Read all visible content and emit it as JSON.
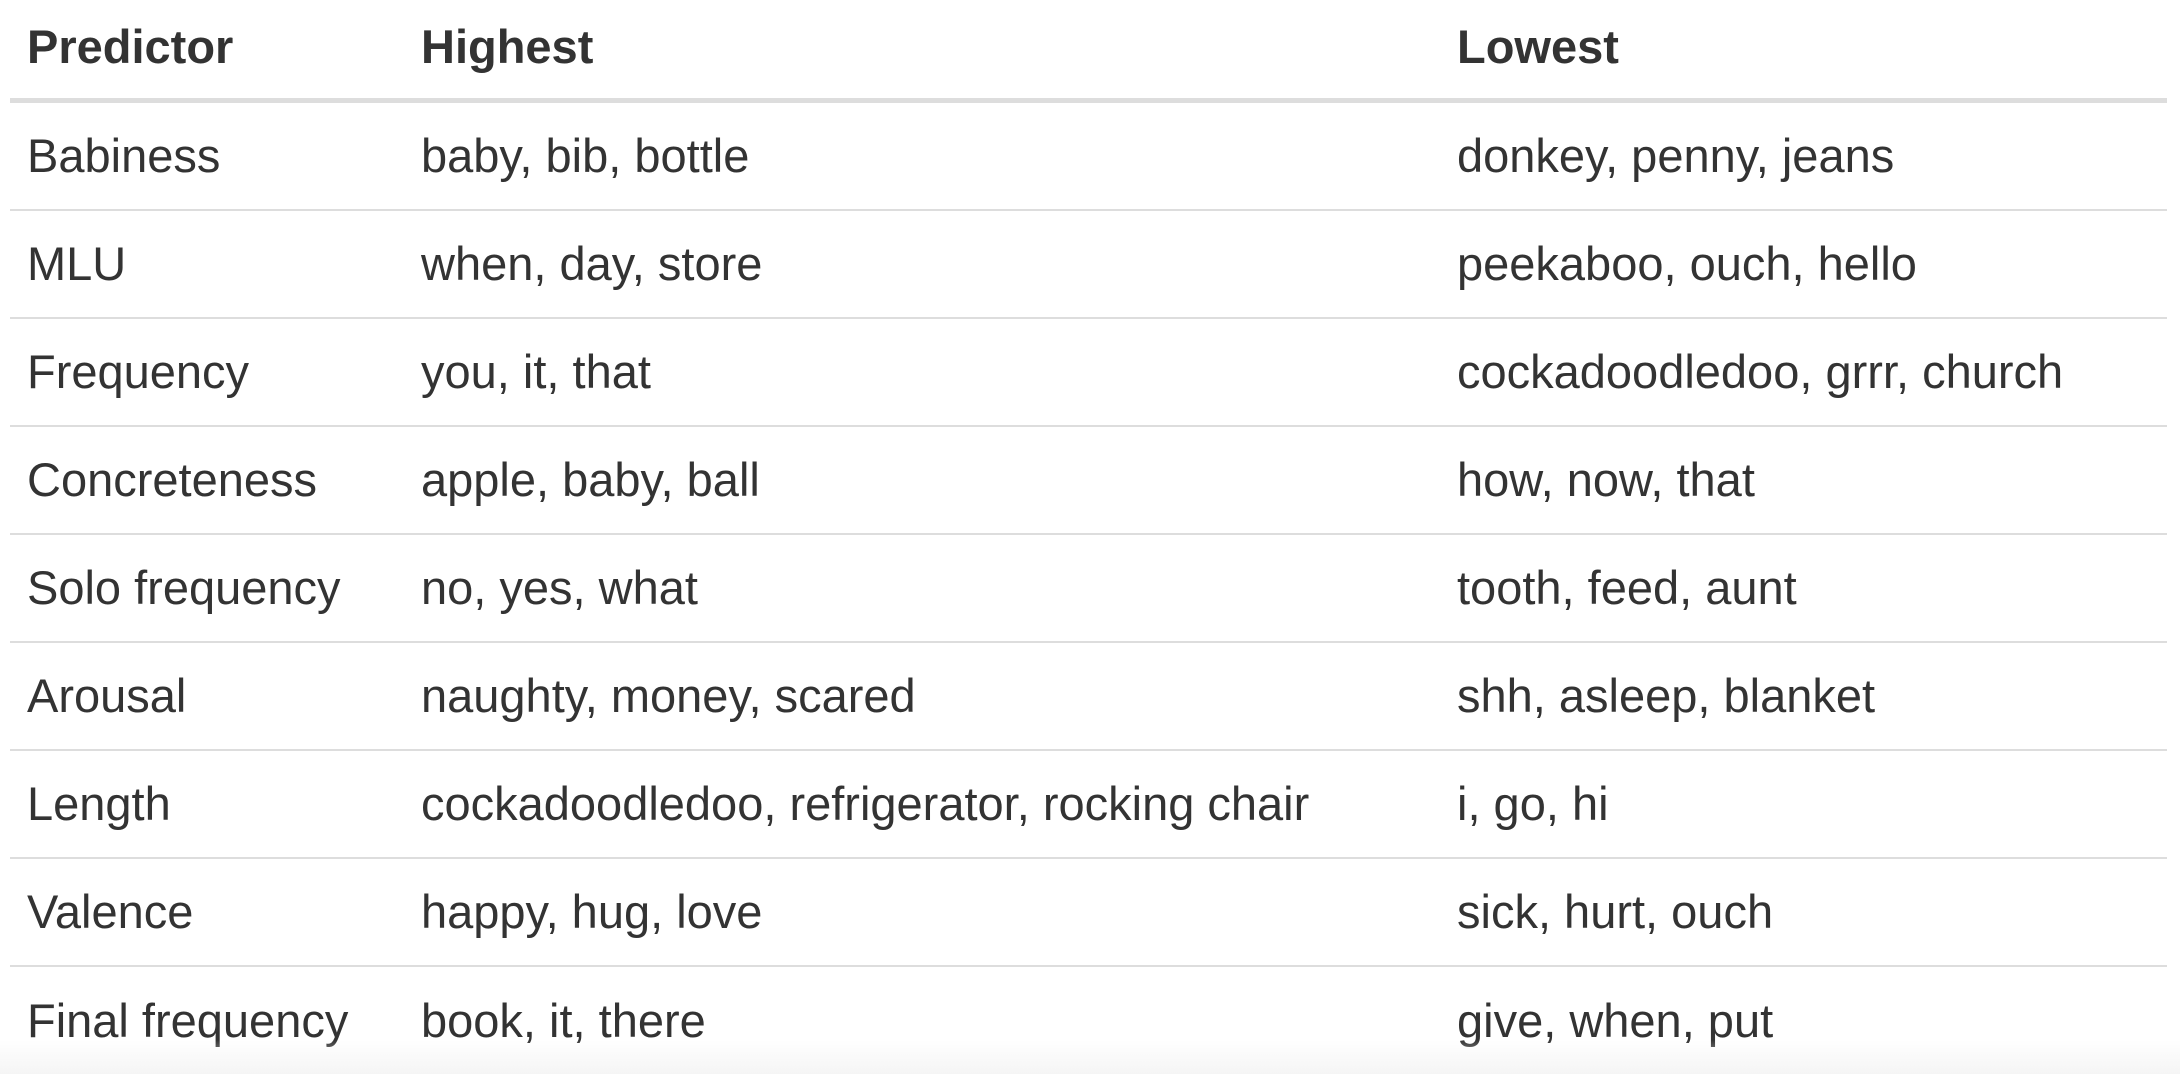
{
  "table": {
    "headers": [
      "Predictor",
      "Highest",
      "Lowest"
    ],
    "rows": [
      [
        "Babiness",
        "baby, bib, bottle",
        "donkey, penny, jeans"
      ],
      [
        "MLU",
        "when, day, store",
        "peekaboo, ouch, hello"
      ],
      [
        "Frequency",
        "you, it, that",
        "cockadoodledoo, grrr, church"
      ],
      [
        "Concreteness",
        "apple, baby, ball",
        "how, now, that"
      ],
      [
        "Solo frequency",
        "no, yes, what",
        "tooth, feed, aunt"
      ],
      [
        "Arousal",
        "naughty, money, scared",
        "shh, asleep, blanket"
      ],
      [
        "Length",
        "cockadoodledoo, refrigerator, rocking chair",
        "i, go, hi"
      ],
      [
        "Valence",
        "happy, hug, love",
        "sick, hurt, ouch"
      ],
      [
        "Final frequency",
        "book, it, there",
        "give, when, put"
      ]
    ]
  }
}
